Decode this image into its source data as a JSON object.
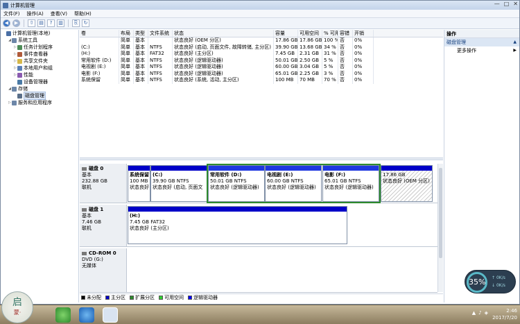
{
  "window": {
    "title": "计算机管理",
    "controls": [
      "—",
      "□",
      "✕"
    ]
  },
  "menu": [
    "文件(F)",
    "操作(A)",
    "查看(V)",
    "帮助(H)"
  ],
  "toolbar": {
    "icons": [
      "back-icon",
      "forward-icon",
      "up-icon",
      "properties-icon",
      "help-icon",
      "show-hide-icon",
      "export-icon",
      "refresh-icon"
    ]
  },
  "tree": [
    {
      "label": "计算机管理(本地)",
      "level": 0,
      "exp": "",
      "color": "#4a6fa5"
    },
    {
      "label": "系统工具",
      "level": 1,
      "exp": "◢",
      "color": "#6d87a8"
    },
    {
      "label": "任务计划程序",
      "level": 2,
      "exp": "▷",
      "color": "#4d8c57"
    },
    {
      "label": "事件查看器",
      "level": 2,
      "exp": "▷",
      "color": "#b05a3a"
    },
    {
      "label": "共享文件夹",
      "level": 2,
      "exp": "▷",
      "color": "#d6b84a"
    },
    {
      "label": "本地用户和组",
      "level": 2,
      "exp": "▷",
      "color": "#5a7fb6"
    },
    {
      "label": "性能",
      "level": 2,
      "exp": "▷",
      "color": "#8a5ab0"
    },
    {
      "label": "设备管理器",
      "level": 2,
      "exp": "",
      "color": "#4a7aa5"
    },
    {
      "label": "存储",
      "level": 1,
      "exp": "◢",
      "color": "#6d87a8"
    },
    {
      "label": "磁盘管理",
      "level": 2,
      "exp": "",
      "color": "#5a6f8a",
      "selected": true
    },
    {
      "label": "服务和应用程序",
      "level": 1,
      "exp": "▷",
      "color": "#6d87a8"
    }
  ],
  "volumes": {
    "headers": [
      "卷",
      "布局",
      "类型",
      "文件系统",
      "状态",
      "容量",
      "可用空间",
      "% 可用",
      "容错",
      "开销"
    ],
    "rows": [
      [
        "",
        "简单",
        "基本",
        "",
        "状态良好 (OEM 分区)",
        "17.86 GB",
        "17.86 GB",
        "100 %",
        "否",
        "0%"
      ],
      [
        "(C:)",
        "简单",
        "基本",
        "NTFS",
        "状态良好 (启动, 页面文件, 故障转储, 主分区)",
        "39.90 GB",
        "13.68 GB",
        "34 %",
        "否",
        "0%"
      ],
      [
        "(H:)",
        "简单",
        "基本",
        "FAT32",
        "状态良好 (主分区)",
        "7.45 GB",
        "2.31 GB",
        "31 %",
        "否",
        "0%"
      ],
      [
        "常用软件 (D:)",
        "简单",
        "基本",
        "NTFS",
        "状态良好 (逻辑驱动器)",
        "50.01 GB",
        "2.50 GB",
        "5 %",
        "否",
        "0%"
      ],
      [
        "电视剧 (E:)",
        "简单",
        "基本",
        "NTFS",
        "状态良好 (逻辑驱动器)",
        "60.00 GB",
        "3.04 GB",
        "5 %",
        "否",
        "0%"
      ],
      [
        "电影 (F:)",
        "简单",
        "基本",
        "NTFS",
        "状态良好 (逻辑驱动器)",
        "65.01 GB",
        "2.25 GB",
        "3 %",
        "否",
        "0%"
      ],
      [
        "系统保留",
        "简单",
        "基本",
        "NTFS",
        "状态良好 (系统, 活动, 主分区)",
        "100 MB",
        "70 MB",
        "70 %",
        "否",
        "0%"
      ]
    ]
  },
  "disks": [
    {
      "name": "磁盘 0",
      "type": "基本",
      "size": "232.88 GB",
      "status": "联机",
      "partitions": [
        {
          "name": "系统保留",
          "size": "100 MB",
          "status": "状态良好"
        },
        {
          "name": "(C:)",
          "size": "39.90 GB NTFS",
          "status": "状态良好 (启动, 页面文"
        },
        {
          "name": "常用软件 (D:)",
          "size": "50.01 GB NTFS",
          "status": "状态良好 (逻辑驱动器)"
        },
        {
          "name": "电视剧 (E:)",
          "size": "60.00 GB NTFS",
          "status": "状态良好 (逻辑驱动器)"
        },
        {
          "name": "电影 (F:)",
          "size": "65.01 GB NTFS",
          "status": "状态良好 (逻辑驱动器)"
        },
        {
          "name": "",
          "size": "17.86 GB",
          "status": "状态良好 (OEM 分区)"
        }
      ]
    },
    {
      "name": "磁盘 1",
      "type": "基本",
      "size": "7.46 GB",
      "status": "联机",
      "partitions": [
        {
          "name": "(H:)",
          "size": "7.45 GB FAT32",
          "status": "状态良好 (主分区)"
        }
      ]
    },
    {
      "name": "CD-ROM 0",
      "type": "DVD (G:)",
      "size": "",
      "status": "无媒体",
      "partitions": []
    }
  ],
  "legend": [
    {
      "label": "未分配",
      "color": "#000000"
    },
    {
      "label": "主分区",
      "color": "#0000c8"
    },
    {
      "label": "扩展分区",
      "color": "#2e8b2e"
    },
    {
      "label": "可用空间",
      "color": "#33cc33"
    },
    {
      "label": "逻辑驱动器",
      "color": "#0000ff"
    }
  ],
  "actions": {
    "header": "操作",
    "section": "磁盘管理",
    "item": "更多操作"
  },
  "meter": {
    "percent": "35%",
    "up": "0K/s",
    "down": "0K/s"
  },
  "taskbar": {
    "time": "2:46",
    "date": "2017/7/20",
    "logo_char": "启",
    "logo_sub": "蒙·"
  }
}
